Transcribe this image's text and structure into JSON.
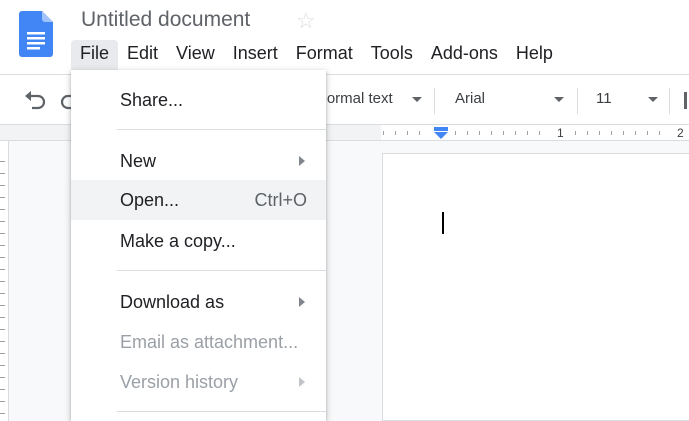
{
  "document": {
    "title": "Untitled document",
    "star_icon": "star-outline-icon"
  },
  "menubar": {
    "items": [
      "File",
      "Edit",
      "View",
      "Insert",
      "Format",
      "Tools",
      "Add-ons",
      "Help"
    ],
    "active": "File"
  },
  "toolbar": {
    "style": "Normal text",
    "font": "Arial",
    "size": "11"
  },
  "ruler": {
    "labels": [
      "1",
      "2"
    ]
  },
  "file_menu": {
    "items": [
      {
        "label": "Share...",
        "shortcut": "",
        "submenu": false,
        "disabled": false
      },
      {
        "label": "New",
        "shortcut": "",
        "submenu": true,
        "disabled": false
      },
      {
        "label": "Open...",
        "shortcut": "Ctrl+O",
        "submenu": false,
        "disabled": false,
        "highlighted": true
      },
      {
        "label": "Make a copy...",
        "shortcut": "",
        "submenu": false,
        "disabled": false
      },
      {
        "label": "Download as",
        "shortcut": "",
        "submenu": true,
        "disabled": false
      },
      {
        "label": "Email as attachment...",
        "shortcut": "",
        "submenu": false,
        "disabled": true
      },
      {
        "label": "Version history",
        "shortcut": "",
        "submenu": true,
        "disabled": true
      }
    ]
  },
  "colors": {
    "docs_blue": "#4285f4",
    "menu_hover": "#f1f3f4",
    "disabled_text": "#9aa0a6"
  }
}
